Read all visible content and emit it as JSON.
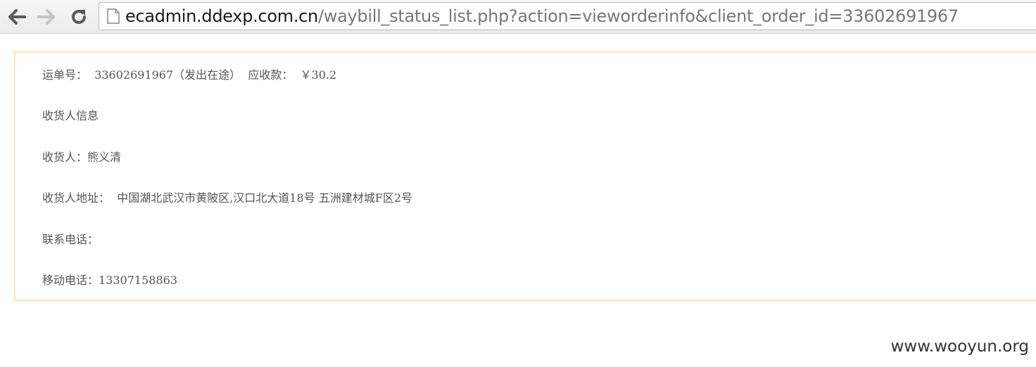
{
  "browser": {
    "url_host": "ecadmin.ddexp.com.cn",
    "url_path": "/waybill_status_list.php?action=vieworderinfo&client_order_id=33602691967",
    "icons": {
      "back": "arrow-left-icon",
      "forward": "arrow-right-icon",
      "reload": "reload-icon",
      "page": "page-icon"
    }
  },
  "order": {
    "waybill_label": "运单号：",
    "waybill_value": "33602691967（发出在途）",
    "amount_label": "应收款：",
    "amount_value": "￥30.2"
  },
  "receiver": {
    "section_title": "收货人信息",
    "name_label": "收货人：",
    "name_value": "熊义清",
    "address_label": "收货人地址：",
    "address_value": "中国湖北武汉市黄陂区,汉口北大道18号 五洲建材城F区2号",
    "phone_label": "联系电话：",
    "phone_value": "",
    "mobile_label": "移动电话：",
    "mobile_value": "13307158863"
  },
  "watermark": "www.wooyun.org",
  "colors": {
    "box_border": "#fbe8a6",
    "text": "#555555",
    "url_host": "#1a1a1a",
    "url_path": "#777777"
  }
}
